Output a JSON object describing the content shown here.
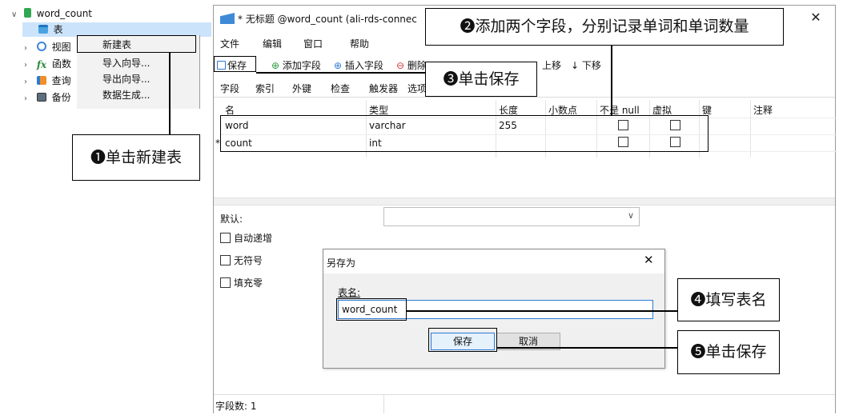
{
  "navigator": {
    "db_name": "word_count",
    "items": [
      {
        "label": "表"
      },
      {
        "label": "视图"
      },
      {
        "label": "函数"
      },
      {
        "label": "查询"
      },
      {
        "label": "备份"
      }
    ],
    "context_menu": [
      "新建表",
      "导入向导...",
      "导出向导...",
      "数据生成..."
    ]
  },
  "window": {
    "title": "* 无标题 @word_count (ali-rds-connec",
    "close": "✕",
    "menus": [
      "文件",
      "编辑",
      "窗口",
      "帮助"
    ],
    "toolbar": {
      "save": "保存",
      "add_field": "添加字段",
      "insert_field": "插入字段",
      "delete_field": "删除",
      "move_up": "上移",
      "move_down": "下移"
    },
    "tabs": [
      "字段",
      "索引",
      "外键",
      "检查",
      "触发器",
      "选项"
    ],
    "columns": [
      "名",
      "类型",
      "长度",
      "小数点",
      "不是 null",
      "虚拟",
      "键",
      "注释"
    ],
    "rows": [
      {
        "marker": "",
        "name": "word",
        "type": "varchar",
        "length": "255"
      },
      {
        "marker": "*",
        "name": "count",
        "type": "int",
        "length": ""
      }
    ],
    "default_label": "默认:",
    "options": [
      "自动递增",
      "无符号",
      "填充零"
    ],
    "status": "字段数: 1"
  },
  "dialog": {
    "title": "另存为",
    "close": "✕",
    "label": "表名:",
    "value": "word_count",
    "save": "保存",
    "cancel": "取消"
  },
  "callouts": {
    "c1": "❶单击新建表",
    "c2": "❷添加两个字段，分别记录单词和单词数量",
    "c3": "❸单击保存",
    "c4": "❹填写表名",
    "c5": "❺单击保存"
  },
  "icons": {
    "db": "database-icon",
    "table": "table-icon",
    "view": "view-icon",
    "function": "function-icon",
    "query": "query-icon",
    "backup": "backup-icon"
  }
}
